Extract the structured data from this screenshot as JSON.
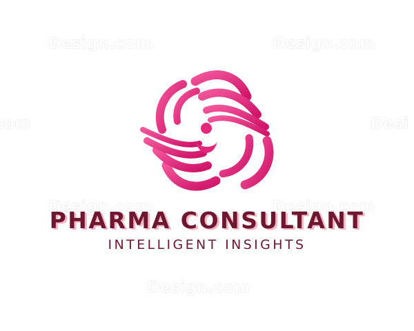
{
  "watermark": {
    "text": "Design.com",
    "partial_left": "com",
    "partial_right": "Desi"
  },
  "brand": {
    "name": "PHARMA CONSULTANT",
    "tagline": "INTELLIGENT INSIGHTS"
  },
  "colors": {
    "brand_dark": "#6e1730",
    "brand_shadow": "#f7b6c4",
    "icon_pink": "#ef3f8a",
    "icon_magenta": "#d21a6c"
  },
  "logo": {
    "icon": "swirl-person-icon"
  }
}
